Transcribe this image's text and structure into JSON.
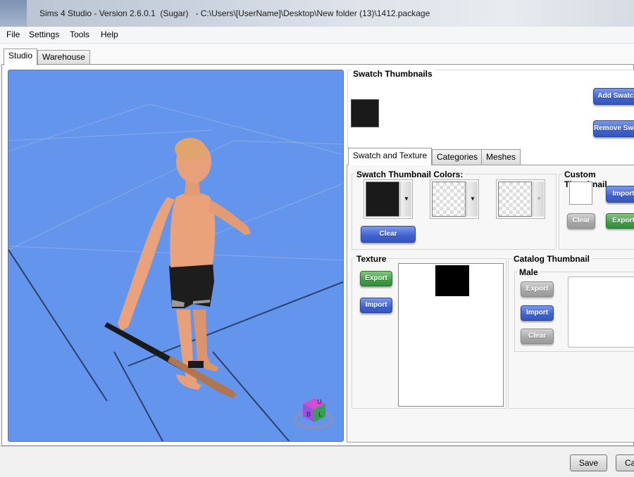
{
  "window": {
    "title": "Sims 4 Studio - Version 2.6.0.1  (Sugar)   - C:\\Users\\[UserName]\\Desktop\\New folder (13)\\1412.package"
  },
  "menu": [
    "File",
    "Settings",
    "Tools",
    "Help"
  ],
  "top_tabs": [
    "Studio",
    "Warehouse"
  ],
  "swatch": {
    "title": "Swatch Thumbnails",
    "add_label": "Add Swatch",
    "remove_label": "Remove Swatch",
    "color": "#1a1a1a"
  },
  "inner_tabs": [
    "Swatch and Texture",
    "Categories",
    "Meshes"
  ],
  "thumbnail_colors": {
    "title": "Swatch Thumbnail Colors:",
    "clear_label": "Clear",
    "wells": [
      {
        "color": "#1a1a1a",
        "dropdown": "▼"
      },
      {
        "color": "transparent",
        "dropdown": "▼"
      },
      {
        "color": "transparent",
        "dropdown": "▼"
      }
    ]
  },
  "custom_thumbnail": {
    "title": "Custom Thumbnail",
    "import_label": "Import",
    "clear_label": "Clear",
    "export_label": "Export"
  },
  "texture": {
    "title": "Texture",
    "export_label": "Export",
    "import_label": "Import"
  },
  "catalog_thumbnail": {
    "title": "Catalog Thumbnail",
    "male_label": "Male",
    "export_label": "Export",
    "import_label": "Import",
    "clear_label": "Clear"
  },
  "bottom": {
    "save_label": "Save",
    "cancel_label": "Cancel"
  },
  "viewport": {
    "background": "#6495ed",
    "gizmo_letters": [
      "U",
      "B",
      "L"
    ]
  }
}
